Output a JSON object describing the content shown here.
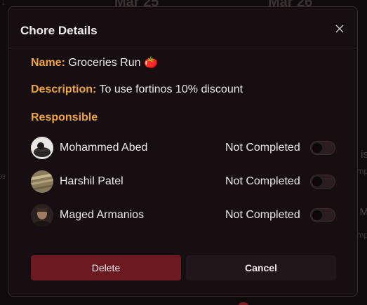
{
  "background": {
    "dates": [
      "Mar 25",
      "Mar 26"
    ],
    "fragments": [
      "is",
      "mp",
      "te",
      "M",
      "mp"
    ]
  },
  "modal": {
    "title": "Chore Details",
    "close_icon": "close-icon"
  },
  "chore": {
    "name_label": "Name:",
    "name_value": "Groceries Run 🍅",
    "description_label": "Description:",
    "description_value": "To use fortinos 10% discount",
    "responsible_label": "Responsible"
  },
  "responsible": [
    {
      "name": "Mohammed Abed",
      "status": "Not Completed",
      "completed": false
    },
    {
      "name": "Harshil Patel",
      "status": "Not Completed",
      "completed": false
    },
    {
      "name": "Maged Armanios",
      "status": "Not Completed",
      "completed": false
    }
  ],
  "actions": {
    "delete_label": "Delete",
    "cancel_label": "Cancel"
  },
  "colors": {
    "accent": "#f0a53c",
    "delete_bg": "#6a1a20",
    "modal_bg": "#160e10"
  }
}
